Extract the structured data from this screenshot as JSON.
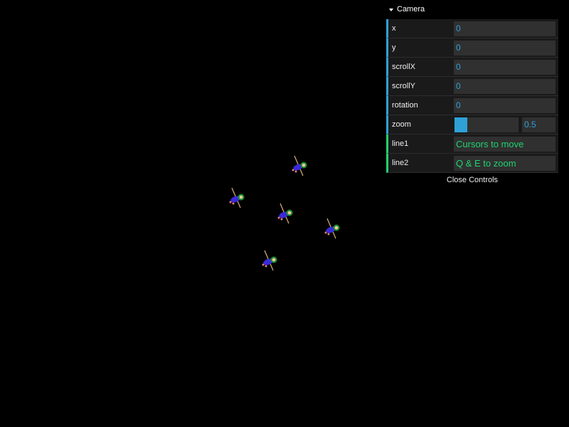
{
  "panel": {
    "folder_title": "Camera",
    "close_label": "Close Controls",
    "rows": [
      {
        "label": "x",
        "value": "0"
      },
      {
        "label": "y",
        "value": "0"
      },
      {
        "label": "scrollX",
        "value": "0"
      },
      {
        "label": "scrollY",
        "value": "0"
      },
      {
        "label": "rotation",
        "value": "0"
      }
    ],
    "zoom": {
      "label": "zoom",
      "value": "0.5",
      "fraction": 0.2
    },
    "line1": {
      "label": "line1",
      "value": "Cursors to move"
    },
    "line2": {
      "label": "line2",
      "value": "Q & E to zoom"
    }
  },
  "colors": {
    "number_accent": "#2fa1d6",
    "string_accent": "#1ed36f",
    "background": "#000000"
  },
  "sprites": {
    "icon": "character-sprite-icon",
    "count": 5
  }
}
